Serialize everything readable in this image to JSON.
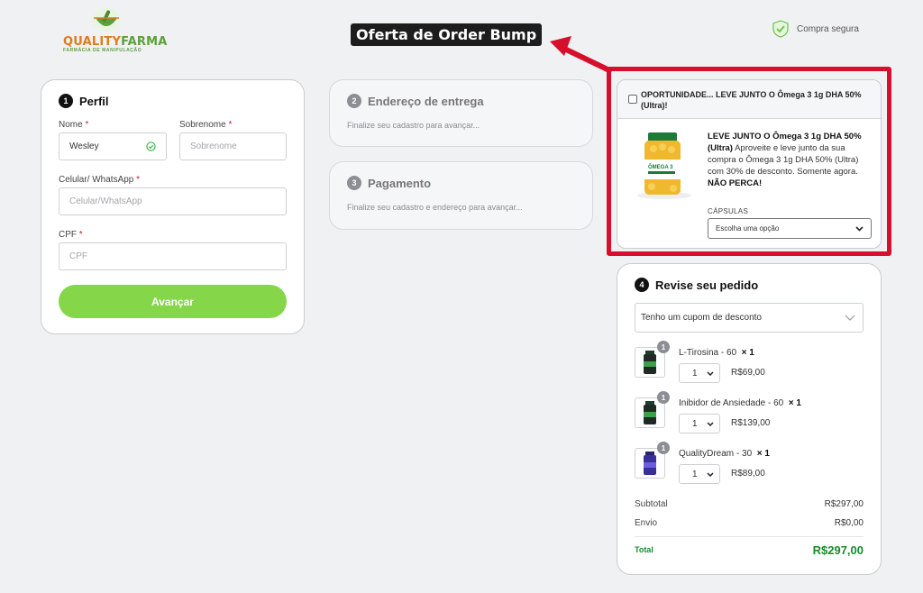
{
  "brand": {
    "name_part1": "QUALITY",
    "name_part2": "FARMA",
    "tagline": "FARMÁCIA DE MANIPULAÇÃO"
  },
  "header": {
    "secure_label": "Compra segura",
    "banner": "Oferta de Order Bump"
  },
  "profile": {
    "step": "1",
    "title": "Perfil",
    "first_name_label": "Nome",
    "first_name_value": "Wesley",
    "last_name_label": "Sobrenome",
    "last_name_placeholder": "Sobrenome",
    "phone_label": "Celular/ WhatsApp",
    "phone_placeholder": "Celular/WhatsApp",
    "cpf_label": "CPF",
    "cpf_placeholder": "CPF",
    "required_mark": "*",
    "submit": "Avançar"
  },
  "delivery": {
    "step": "2",
    "title": "Endereço de entrega",
    "hint": "Finalize seu cadastro para avançar..."
  },
  "payment": {
    "step": "3",
    "title": "Pagamento",
    "hint": "Finalize seu cadastro e endereço para avançar..."
  },
  "bump": {
    "header": "OPORTUNIDADE... LEVE JUNTO O Ômega 3 1g DHA 50% (Ultra)!",
    "desc_bold": "LEVE JUNTO O Ômega 3 1g DHA 50% (Ultra)",
    "desc_text": " Aproveite e leve junto da sua compra o Ômega 3 1g DHA 50% (Ultra) com 30% de desconto. Somente agora. ",
    "desc_end": "NÃO PERCA!",
    "option_label": "CÁPSULAS",
    "option_value": "Escolha uma opção",
    "bottle_label": "ÔMEGA 3"
  },
  "review": {
    "step": "4",
    "title": "Revise seu pedido",
    "coupon": "Tenho um cupom de desconto",
    "items": [
      {
        "name": "L-Tirosina - 60",
        "mult": "× 1",
        "qty": "1",
        "badge": "1",
        "price": "R$69,00"
      },
      {
        "name": "Inibidor de Ansiedade - 60",
        "mult": "× 1",
        "qty": "1",
        "badge": "1",
        "price": "R$139,00"
      },
      {
        "name": "QualityDream - 30",
        "mult": "× 1",
        "qty": "1",
        "badge": "1",
        "price": "R$89,00"
      }
    ],
    "subtotal_label": "Subtotal",
    "subtotal_value": "R$297,00",
    "shipping_label": "Envio",
    "shipping_value": "R$0,00",
    "total_label": "Total",
    "total_value": "R$297,00"
  },
  "colors": {
    "accent_green": "#86d64a",
    "total_green": "#198a2c",
    "highlight_red": "#d6102c"
  }
}
